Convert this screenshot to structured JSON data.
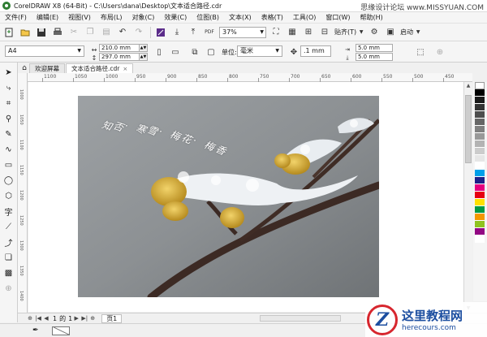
{
  "window": {
    "title": "CorelDRAW X8 (64-Bit) - C:\\Users\\dana\\Desktop\\文本适合路径.cdr",
    "watermark": "思缘设计论坛 www.MISSYUAN.COM"
  },
  "menu": [
    "文件(F)",
    "编辑(E)",
    "视图(V)",
    "布局(L)",
    "对象(C)",
    "效果(C)",
    "位图(B)",
    "文本(X)",
    "表格(T)",
    "工具(O)",
    "窗口(W)",
    "帮助(H)"
  ],
  "toolbar": {
    "zoom_value": "37%",
    "snap_label": "贴齐(T)",
    "launch_label": "启动"
  },
  "propbar": {
    "paper": "A4",
    "width": "210.0 mm",
    "height": "297.0 mm",
    "unit_label": "单位:",
    "unit": "毫米",
    "nudge": ".1 mm",
    "dup_x": "5.0 mm",
    "dup_y": "5.0 mm"
  },
  "tabs": [
    {
      "label": "欢迎屏幕",
      "active": false
    },
    {
      "label": "文本适合路径.cdr",
      "active": true
    }
  ],
  "ruler": {
    "h_labels": [
      "1100",
      "1050",
      "1000",
      "950",
      "900",
      "850",
      "800",
      "750",
      "700",
      "650",
      "600",
      "550",
      "500",
      "450"
    ],
    "v_labels": [
      "1000",
      "1050",
      "1100",
      "1150",
      "1200",
      "1250",
      "1300",
      "1350",
      "1400"
    ]
  },
  "canvas": {
    "path_text": "知否·寒雪·梅花·梅香",
    "path_text_chars": [
      "知",
      "否",
      "·",
      "寒",
      "雪",
      "·",
      "梅",
      "花",
      "·",
      "梅",
      "香"
    ]
  },
  "palette": [
    "#ffffff",
    "#000000",
    "#1a1a1a",
    "#333333",
    "#4d4d4d",
    "#666666",
    "#808080",
    "#999999",
    "#b3b3b3",
    "#cccccc",
    "#e6e6e6",
    "#ffffff",
    "#00a0e9",
    "#1d2088",
    "#e4007f",
    "#e60012",
    "#ffe100",
    "#009944",
    "#f39800",
    "#8fc31f",
    "#920783",
    "#ffffff"
  ],
  "pager": {
    "current": "1",
    "of_label": "的",
    "total": "1",
    "page_tab": "页1"
  },
  "logo": {
    "mark": "Z",
    "main": "这里教程网",
    "sub": "herecours.com"
  }
}
